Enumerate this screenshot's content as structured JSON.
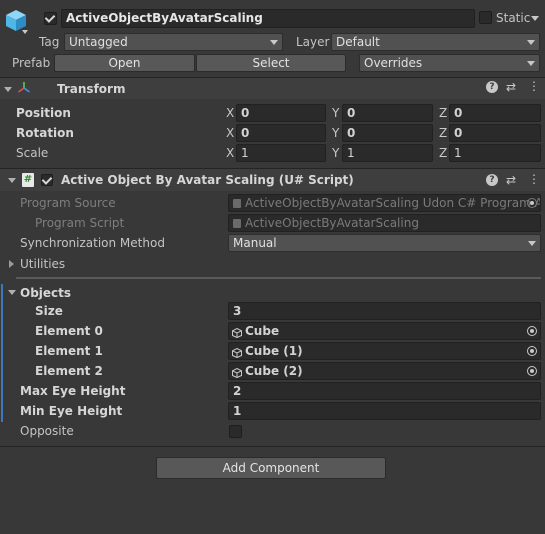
{
  "object": {
    "name": "ActiveObjectByAvatarScaling",
    "active": true,
    "static_label": "Static",
    "static_checked": false,
    "tag_label": "Tag",
    "tag_value": "Untagged",
    "layer_label": "Layer",
    "layer_value": "Default",
    "prefab_label": "Prefab",
    "prefab_open": "Open",
    "prefab_select": "Select",
    "prefab_overrides": "Overrides"
  },
  "transform": {
    "title": "Transform",
    "rows": [
      {
        "label": "Position",
        "x": "0",
        "y": "0",
        "z": "0"
      },
      {
        "label": "Rotation",
        "x": "0",
        "y": "0",
        "z": "0"
      },
      {
        "label": "Scale",
        "x": "1",
        "y": "1",
        "z": "1"
      }
    ],
    "axis_labels": [
      "X",
      "Y",
      "Z"
    ]
  },
  "script": {
    "title": "Active Object By Avatar Scaling (U# Script)",
    "enabled": true,
    "program_source_label": "Program Source",
    "program_source_value": "ActiveObjectByAvatarScaling Udon C# Program A",
    "program_script_label": "Program Script",
    "program_script_value": "ActiveObjectByAvatarScaling",
    "sync_label": "Synchronization Method",
    "sync_value": "Manual",
    "utilities_label": "Utilities",
    "objects_label": "Objects",
    "size_label": "Size",
    "size_value": "3",
    "elements": [
      {
        "label": "Element 0",
        "value": "Cube"
      },
      {
        "label": "Element 1",
        "value": "Cube (1)"
      },
      {
        "label": "Element 2",
        "value": "Cube (2)"
      }
    ],
    "max_eye_label": "Max Eye Height",
    "max_eye_value": "2",
    "min_eye_label": "Min Eye Height",
    "min_eye_value": "1",
    "opposite_label": "Opposite",
    "opposite_checked": false
  },
  "add_component_label": "Add Component",
  "colors": {
    "background": "#383838",
    "field": "#2a2a2a",
    "header": "#3e3e3e",
    "accent_bar": "#3a79bb",
    "icon_cube": "#4fb7e8"
  }
}
